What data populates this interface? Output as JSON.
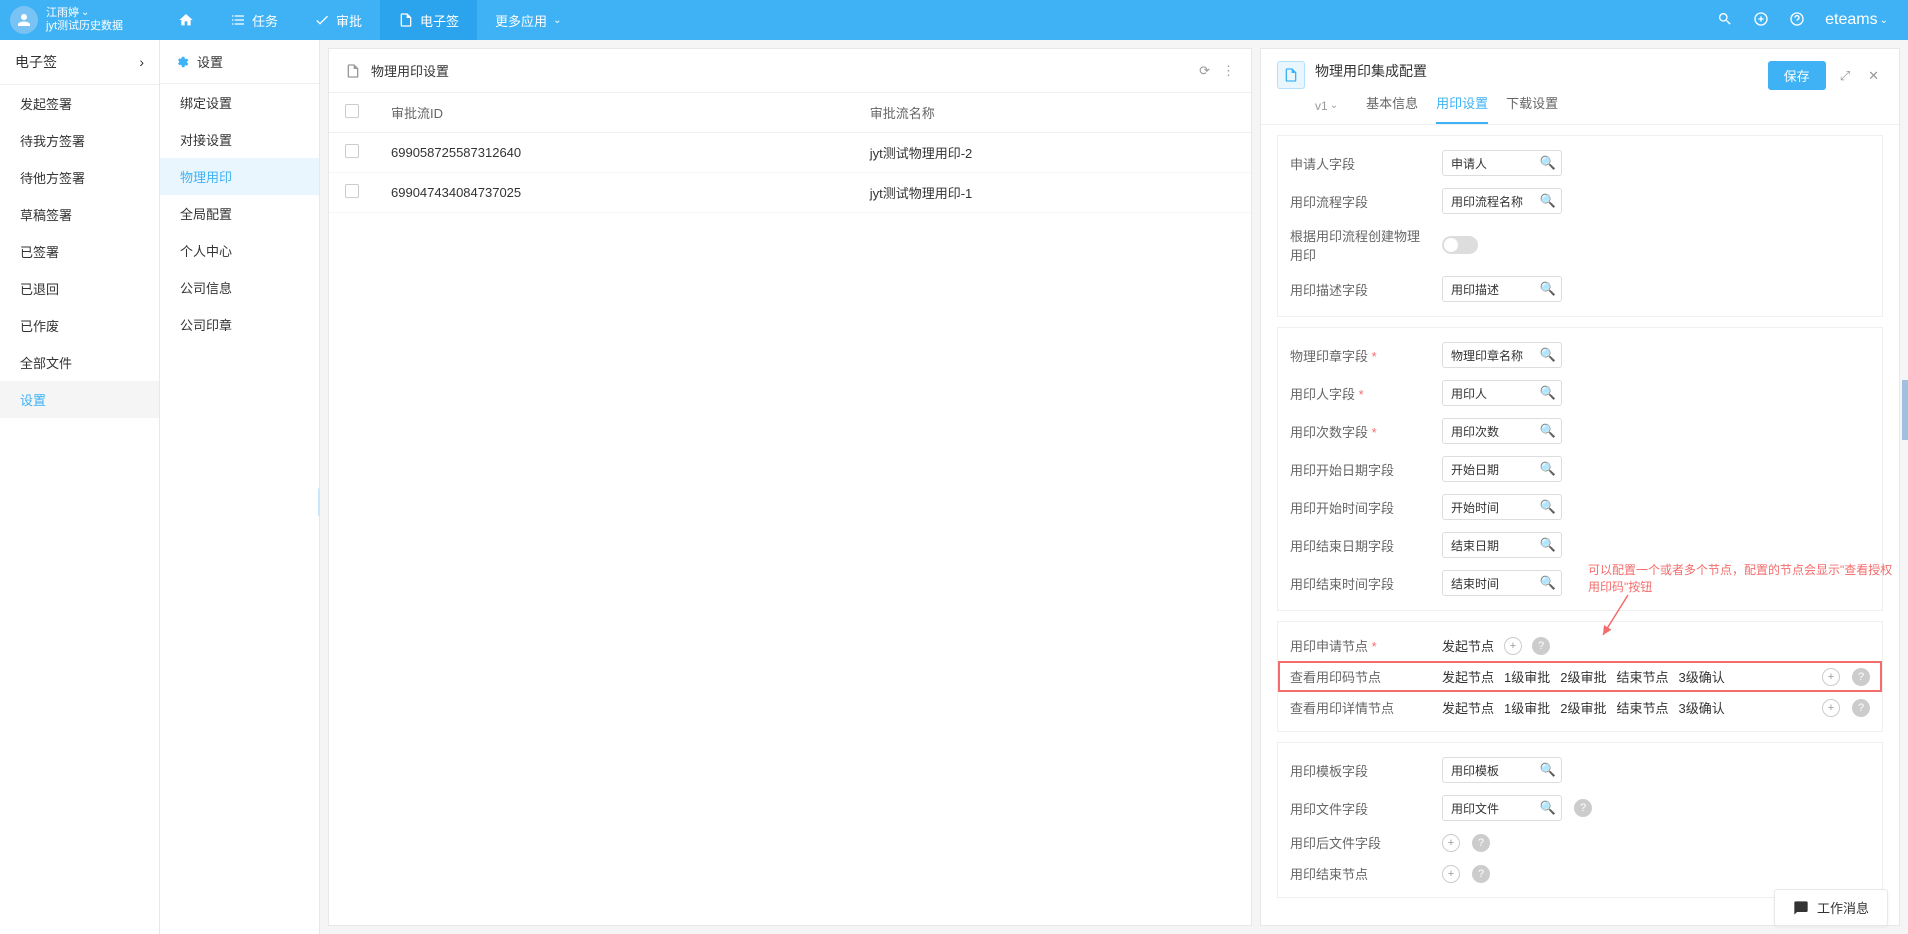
{
  "header": {
    "user_name": "江雨婷",
    "user_subtitle": "jyt测试历史数据",
    "nav": {
      "home": "",
      "tasks": "任务",
      "approval": "审批",
      "esign": "电子签",
      "more": "更多应用"
    },
    "logo": "eteams"
  },
  "sidebar_left": {
    "title": "电子签",
    "items": [
      "发起签署",
      "待我方签署",
      "待他方签署",
      "草稿签署",
      "已签署",
      "已退回",
      "已作废",
      "全部文件",
      "设置"
    ],
    "active": "设置"
  },
  "sidebar_settings": {
    "title": "设置",
    "items": [
      "绑定设置",
      "对接设置",
      "物理用印",
      "全局配置",
      "个人中心",
      "公司信息",
      "公司印章"
    ],
    "active": "物理用印"
  },
  "table_panel": {
    "title": "物理用印设置",
    "columns": [
      "审批流ID",
      "审批流名称"
    ],
    "rows": [
      {
        "id": "699058725587312640",
        "name": "jyt测试物理用印-2"
      },
      {
        "id": "699047434084737025",
        "name": "jyt测试物理用印-1"
      }
    ]
  },
  "detail": {
    "title": "物理用印集成配置",
    "version": "v1",
    "tabs": [
      "基本信息",
      "用印设置",
      "下载设置"
    ],
    "active_tab": "用印设置",
    "save_btn": "保存",
    "section1": {
      "applicant_field": {
        "label": "申请人字段",
        "value": "申请人"
      },
      "process_field": {
        "label": "用印流程字段",
        "value": "用印流程名称"
      },
      "create_physical": {
        "label": "根据用印流程创建物理用印"
      },
      "desc_field": {
        "label": "用印描述字段",
        "value": "用印描述"
      }
    },
    "section2": {
      "seal_field": {
        "label": "物理印章字段",
        "value": "物理印章名称"
      },
      "user_field": {
        "label": "用印人字段",
        "value": "用印人"
      },
      "count_field": {
        "label": "用印次数字段",
        "value": "用印次数"
      },
      "start_date": {
        "label": "用印开始日期字段",
        "value": "开始日期"
      },
      "start_time": {
        "label": "用印开始时间字段",
        "value": "开始时间"
      },
      "end_date": {
        "label": "用印结束日期字段",
        "value": "结束日期"
      },
      "end_time": {
        "label": "用印结束时间字段",
        "value": "结束时间"
      }
    },
    "section3": {
      "apply_node": {
        "label": "用印申请节点",
        "values": [
          "发起节点"
        ]
      },
      "view_code_node": {
        "label": "查看用印码节点",
        "values": [
          "发起节点",
          "1级审批",
          "2级审批",
          "结束节点",
          "3级确认"
        ]
      },
      "view_detail_node": {
        "label": "查看用印详情节点",
        "values": [
          "发起节点",
          "1级审批",
          "2级审批",
          "结束节点",
          "3级确认"
        ]
      }
    },
    "section4": {
      "template_field": {
        "label": "用印模板字段",
        "value": "用印模板"
      },
      "file_field": {
        "label": "用印文件字段",
        "value": "用印文件"
      },
      "after_file_field": {
        "label": "用印后文件字段"
      },
      "end_node": {
        "label": "用印结束节点"
      }
    }
  },
  "annotation": "可以配置一个或者多个节点，配置的节点会显示\"查看授权用印码\"按钮",
  "footer": "工作消息"
}
